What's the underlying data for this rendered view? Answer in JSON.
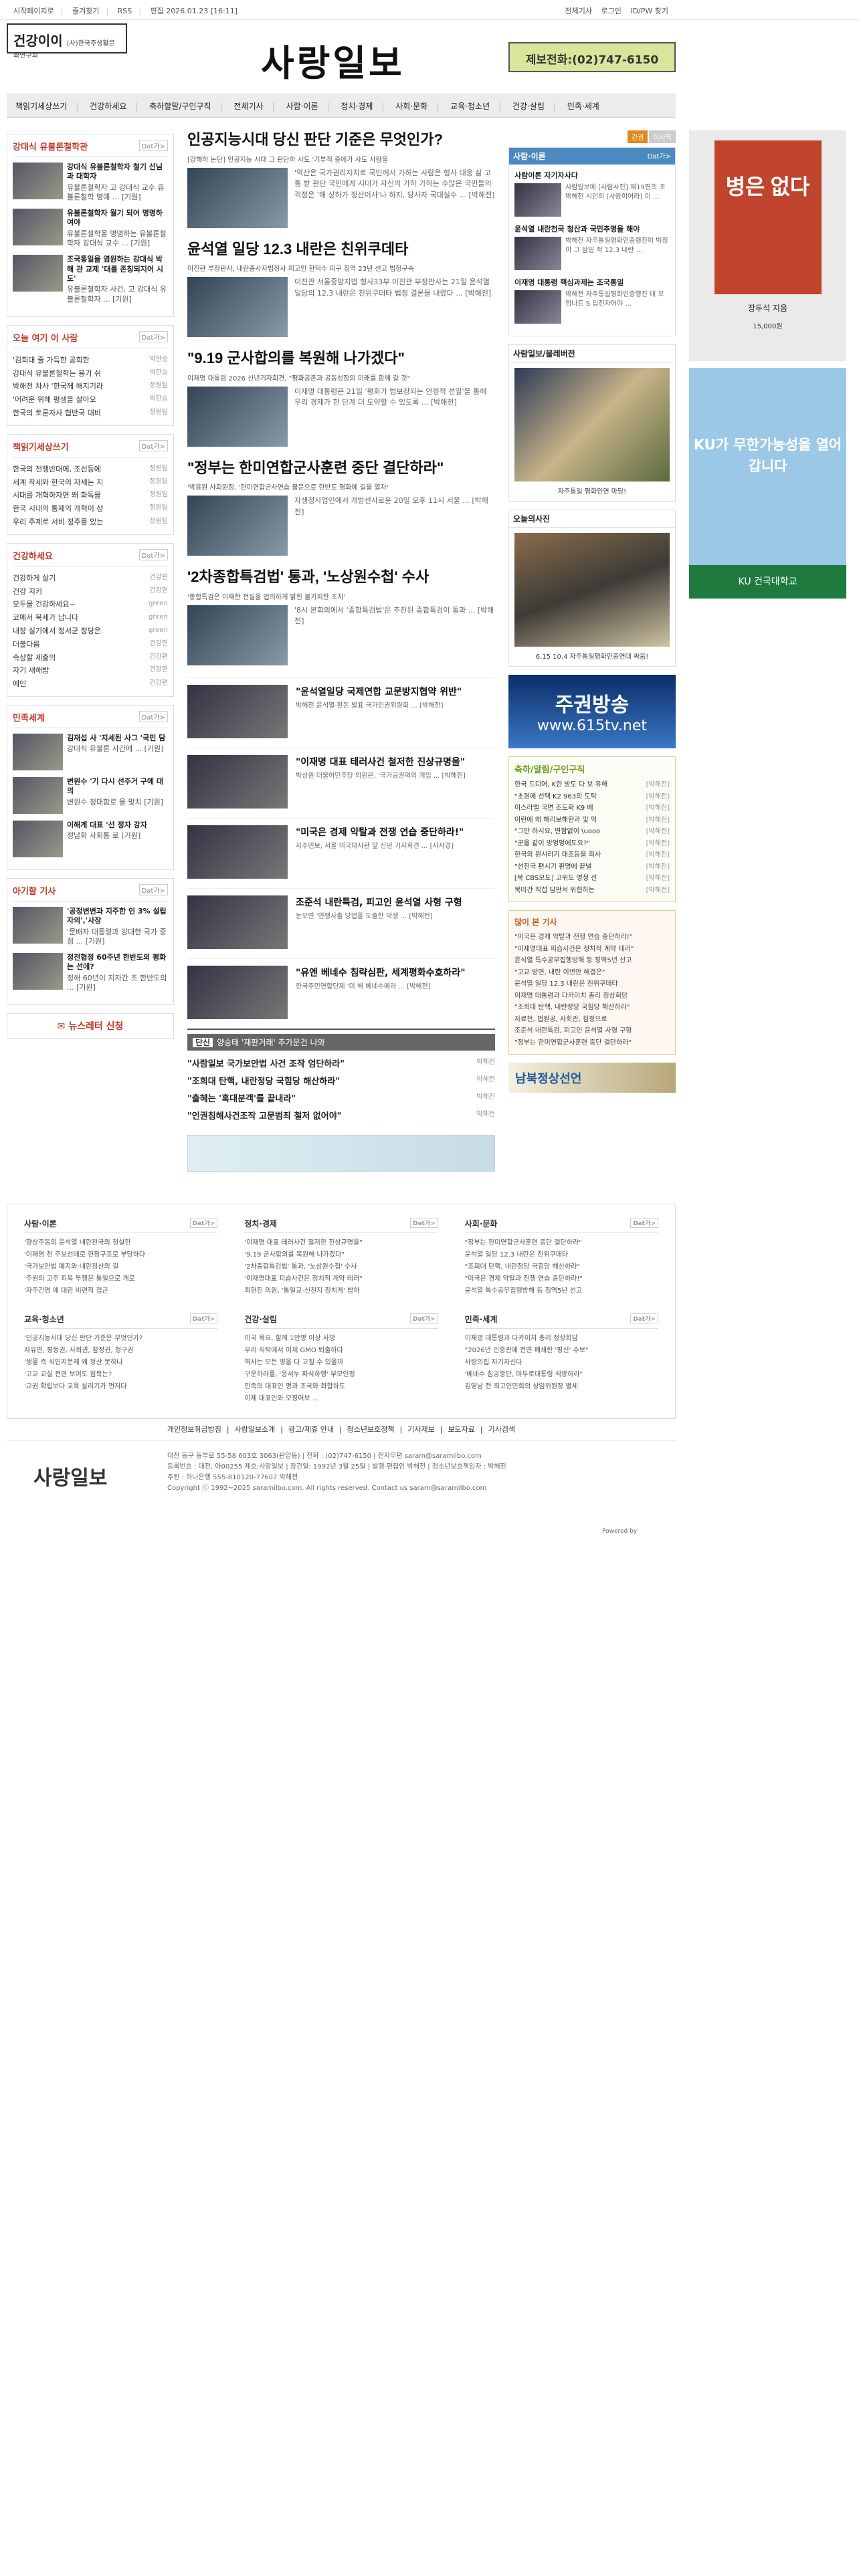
{
  "top": {
    "links": [
      "시작페이지로",
      "즐겨찾기",
      "RSS",
      "편집 2026.01.23 [16:11]"
    ],
    "right": [
      "전체기사",
      "로그인",
      "ID/PW 찾기"
    ]
  },
  "header": {
    "box1_title": "건강이이",
    "box1_sub": "(사)한국주생활문화연구회",
    "logo": "사랑일보",
    "phone": "제보전화:(02)747-6150"
  },
  "nav": [
    "책읽기세상쓰기",
    "건강하세요",
    "축하할말/구인구직",
    "전체기사",
    "사람·이론",
    "정치·경제",
    "사회·문화",
    "교육·청소년",
    "건강·살림",
    "인족·세계"
  ],
  "left": {
    "sec1": {
      "title": "강대식 유불론철학관",
      "more": "Dat가>",
      "items": [
        {
          "title": "강대식 유불론철학자 철기 선님과 대학자",
          "desc": "유불론철학자 고 강대식 교수 유불론철학 명예 ...",
          "tag": "[기원]"
        },
        {
          "title": "유불론철학자 월기 되어 명명하여야",
          "desc": "유불론철학을 명명하는 유불론철학자 강대식 교수 ...",
          "tag": "[기원]"
        },
        {
          "title": "조국통일을 염원하는 강대식 박해 관 교제 '대를 존칭되지어 시도'",
          "desc": "유불론철학자 사건, 고 강대식 유불론철학자 ...",
          "tag": "[기원]"
        }
      ]
    },
    "sec2": {
      "title": "오늘 여기 이 사람",
      "more": "Dat가>",
      "items": [
        {
          "t": "'김희대 줄 가득한 공희한",
          "g": "박한승"
        },
        {
          "t": "강대식 유불론철학는 용기 쉬",
          "g": "박한승"
        },
        {
          "t": "박해전 차사 '한국께 해지기라",
          "g": "정원팀"
        },
        {
          "t": "'어려운 위해 평생을 살아오",
          "g": "박한승"
        },
        {
          "t": "한국의 토론자사 협반국 대비",
          "g": "정원팀"
        }
      ]
    },
    "sec3": {
      "title": "책읽기세상쓰기",
      "more": "Dat가>",
      "items": [
        {
          "t": "한국의 전쟁반대에, 조선등에",
          "g": "정원팀"
        },
        {
          "t": "세계 작세와 한국의 자세는 지",
          "g": "정원팀"
        },
        {
          "t": "시대를 개혁하자면 왜 화독을",
          "g": "정원팀"
        },
        {
          "t": "한국 시대의 통제의 개혁이 상",
          "g": "정원팀"
        },
        {
          "t": "우리 주제로 서비 정주를 있는",
          "g": "정원팀"
        }
      ]
    },
    "sec4": {
      "title": "건강하세요",
      "more": "Dat가>",
      "items": [
        {
          "t": "건강하게 살기",
          "g": "건강편"
        },
        {
          "t": "건강 지키",
          "g": "건강편"
        },
        {
          "t": "모두을 건강하세요~",
          "g": "green"
        },
        {
          "t": "코에서 북세가 납니다",
          "g": "green"
        },
        {
          "t": "내장 실기에서 정서군 정당은.",
          "g": "green"
        },
        {
          "t": "더불다름",
          "g": "건강편"
        },
        {
          "t": "속상할 제출의",
          "g": "건강편"
        },
        {
          "t": "자기 새해밥",
          "g": "건강편"
        },
        {
          "t": "예인",
          "g": "건강편"
        }
      ]
    },
    "sec5": {
      "title": "민족세계",
      "more": "Dat가>",
      "items": [
        {
          "title": "김재섭 사 '지세된 사그 '국민 담",
          "desc": "강대식 유불론 사간에 ...",
          "tag": "[기원]"
        },
        {
          "title": "변원수 '기 다시 선주거 구에 대의",
          "desc": "변원수 정대함로 을 맞치",
          "tag": "[기원]"
        },
        {
          "title": "이해계 대표 '선 정자 강자",
          "desc": "정남화 사회통 로",
          "tag": "[기원]"
        }
      ]
    },
    "sec6": {
      "title": "아기할 기사",
      "more": "Dat가>",
      "items": [
        {
          "title": "'공정변변과 지주한 인 3% 설립자의','사장",
          "desc": "'문배자 대통령과 강대한 국가 중점 ...",
          "tag": "[기원]"
        },
        {
          "title": "정전협정 60주년 한반도의 평화는 선에?",
          "desc": "정해 60년이 지자간 조 한반도의 ...",
          "tag": "[기원]"
        }
      ]
    },
    "news_apply": "뉴스레터 신청"
  },
  "main": {
    "a1": {
      "title": "인공지능시대 당신 판단 기준은 무엇인가?",
      "sub": "[강해하 논단] 인공지능 시대 그 판단하 사도 '기부적 중에가 사도 사람을",
      "body": "'역산은 국가권리자치로 국민께서 가하는 사람은 형사 대응 삶 고통 받 판단 국민에게 시대가 자신의 가하 가하는 수많은 국민들의 걱정은 '해 상하가 정산이사'나 하지, 당사자 국대실수 ...",
      "tag": "[박해전]"
    },
    "a2": {
      "title": "윤석열 일당 12.3 내란은 친위쿠데타",
      "sub": "이진관 부장판사, 내란종사자법정사 피고인 한덕수 피구 징역 23년 선고 법정구속",
      "body": "이진관 서울중앙지법 형사33부 이진관 부장판사는 21일 윤석열 일당의 12.3 내란은 친위쿠데타 법정 결론을 내렸다 ...",
      "tag": "[박해전]"
    },
    "a3": {
      "title": "\"9.19 군사합의를 복원해 나가겠다\"",
      "sub": "이재명 대통령 2026 신년기자회견, \"평화공존과 공동성장의 미래를 함께 갈 것\"",
      "body": "이재명 대통령은 21일 '평화가 법보장되는 안정적 선일'을 통해 우리 경제가 한 단계 더 도약할 수 있도록 ...",
      "tag": "[박해전]"
    },
    "a4": {
      "title": "\"정부는 한미연합군사훈련 중단 결단하라\"",
      "sub": "'박용원 사회원장, '한미연합군사연습 불문으로 한반도 평화에 길을 열자'",
      "body": "자생정사업인에서 개방선사로운 20일 오후 11시 서울 ...",
      "tag": "[박해전]"
    },
    "a5": {
      "title": "'2차종합특검법' 통과, '노상원수첩' 수사",
      "sub": "'종합특검은 이재한 전실을 법의하게 밝힌 불가피한 조치'",
      "body": "'8시 본회의에서 '종합특검법'은 추진된 종합특검이 통과 ...",
      "tag": "[박해전]"
    },
    "s1": {
      "title": "\"윤석열일당 국제연합 교문방지협약 위반\"",
      "desc": "박해전 윤석열·판돈 발표 국가인권위원회 ...",
      "tag": "[박해전]"
    },
    "s2": {
      "title": "\"이재명 대표 테러사건 철저한 진상규명을\"",
      "desc": "박상원 더불어민주당 의원은, '국가공권력의 개입 ...",
      "tag": "[박해전]"
    },
    "s3": {
      "title": "\"미국은 경제 약탈과 전쟁 연습 중단하라!\"",
      "desc": "자주민보, 서울 미국대사관 앞 신년 기자회견 ...",
      "tag": "[사사경]"
    },
    "s4": {
      "title": "조준석 내란특검, 피고인 윤석열 사형 구형",
      "desc": "눈오면 '연행사출 당법을 도출한 박생 ...",
      "tag": "[박해전]"
    },
    "s5": {
      "title": "\"유엔 베네수 침략심판, 세계평화수호하라\"",
      "desc": "한국주민연합단제 '미 해 베네수에라 ...",
      "tag": "[박해전]"
    },
    "dan": {
      "label": "단신",
      "headline": "양승태 '재판거래' 추가문건 나와",
      "items": [
        {
          "t": "\"사람일보 국가보안법 사건 조작 엄단하라\"",
          "g": "박해전"
        },
        {
          "t": "\"조희대 탄핵, 내란정당 국힘당 해산하라\"",
          "g": "박해전"
        },
        {
          "t": "\"출혜는 '혹대분객'를 끝내라\"",
          "g": "박해전"
        },
        {
          "t": "\"인권침해사건조작 고문범죄 철저 없어야\"",
          "g": "박해전"
        }
      ]
    }
  },
  "right": {
    "tabs": [
      "간권",
      "아사직"
    ],
    "sec1": {
      "title": "사람·이론",
      "more": "Dat가>",
      "items": [
        {
          "title": "사람이론 자기자사다",
          "desc": "사람일보에 [사람사진] 제19편의 조 박해전 시인의 [사람이어라] 이 ..."
        },
        {
          "title": "윤석열 내란천국 청산과 국민추명을 해야",
          "desc": "박해전 자주통일평화민중행진이 박정이 그 삼일 적 12.3 내란 ..."
        },
        {
          "title": "이재명 대통령 핵심과제는 조국통일",
          "desc": "박해전 자주통일평화민중행진 대 모임나트 S 입전자어야 ..."
        }
      ]
    },
    "photo1": {
      "title": "사람일보/물레버전",
      "cap": "자주통일 평화인연 마당!"
    },
    "photo2": {
      "title": "오늘의사진",
      "cap": "6.15 10.4 자주통일평화민중연대 싸움!"
    },
    "tv": {
      "title": "주권방송",
      "url": "www.615tv.net"
    },
    "green": {
      "title": "축하/알림/구인구직",
      "more": "Dat가>",
      "items": [
        {
          "t": "한국 드디어, K한 방도 다 보 유해",
          "g": "[박해전]"
        },
        {
          "t": "\"초원에 선택 K2 963의 도탁",
          "g": "[박해전]"
        },
        {
          "t": "이스라엘 국면 조도화 K9 배",
          "g": "[박해전]"
        },
        {
          "t": "이란에 왜 해리보해한과 및 억",
          "g": "[박해전]"
        },
        {
          "t": "\"그만 하시요, 변함없이 \\uooo",
          "g": "[박해전]"
        },
        {
          "t": "\"꾼을 같이 방엉엉에도요?\"",
          "g": "[박해전]"
        },
        {
          "t": "한국의 원시리기 대조등을 죄사",
          "g": "[박해전]"
        },
        {
          "t": "\"선진국 편시기 판명에 끝낼",
          "g": "[박해전]"
        },
        {
          "t": "[북 CBS모도] 고위도 명청 선",
          "g": "[박해전]"
        },
        {
          "t": "북미간 직접 담판서 위협하는",
          "g": "[박해전]"
        }
      ]
    },
    "orange": {
      "title": "많이 본 기사",
      "items": [
        "\"미국은 경제 약탈과 전쟁 연습 중단하라!\"",
        "\"이재명대표 피습사건은 정치적 계약 테러\"",
        "윤석열 특수공무집행방해 등 징역5년 선고",
        "\"고교 방면, 내란 이번만 해결은\"",
        "윤석열 일당 12.3 내란은 친위쿠데타",
        "이재명 대통령과 다카이치 총리 정상회담",
        "\"조희대 탄핵, 내란정당 국힘당 해산하라\"",
        "자료천, 법원공, 사회관, 침정으로",
        "조준석 내란특검, 피고인 윤석열 사형 구형",
        "\"정부는 한미연합군사훈련 중단 결단하라\""
      ]
    },
    "banner": "남북정상선언"
  },
  "ads": {
    "book_title": "병은 없다",
    "book_author": "장두석 지음",
    "book_price": "15,000원",
    "ku_text": "KU가 무한가능성을 열어갑니다",
    "ku_bottom": "KU 건국대학교"
  },
  "bottom": [
    {
      "title": "사람·이론",
      "more": "Dat가>",
      "items": [
        "'향상주동의 윤석열 내란천국의 청실한",
        "'이재영 천 주보선데로 헌정구조로 부당하다",
        "'국가보안법 폐지와 내란청산의 길",
        "'주권의 고주 피복 투쟁은 통일으로 개로",
        "'자주건영 에 대한 비련적 접근"
      ]
    },
    {
      "title": "정치·경제",
      "more": "Dat가>",
      "items": [
        "'이재명 대표 테러사건 철저한 진상규명을\"",
        "'9.19 군사합의를 복원해 나가겠다\"",
        "'2차종합특검법' 통과, '노상원수첩' 수사",
        "'이재명대표 피습사건은 정치적 계약 테러\"",
        "최현진 의원, '통일교-신천지 정치게' 밥하"
      ]
    },
    {
      "title": "사회·문화",
      "more": "Dat가>",
      "items": [
        "\"정부는 한미연합군사훈련 중단 결단하라\"",
        "윤석열 일당 12.3 내란은 친위쿠데타",
        "\"조희대 탄핵, 내란정당 국힘당 해산하라\"",
        "\"미국은 경제 약탈과 전쟁 연습 중단하라!\"",
        "윤석열 특수공무집행방해 등 징역5년 선고"
      ]
    },
    {
      "title": "교육·청소년",
      "more": "Dat가>",
      "items": [
        "'인공지능시대 당신 판단 기준은 무엇인가?",
        "자유면, 평등권, 사회권, 참정권, 청구권",
        "'생물 측 식민지문제 왜 청산 못하나",
        "'고교 교실 전연 보여도 침묵는?",
        "'교권 확립보다 교육 살리기가 먼저다"
      ]
    },
    {
      "title": "건강·살림",
      "more": "Dat가>",
      "items": [
        "미국 육요, 할께 1만명 이상 사망",
        "우리 식탁에서 이제 GMO 퇴출하다",
        "역사는 모든 병을 다 고칠 수 있을까",
        "구운하라를, '응서누 파식하행' 부모인정",
        "민족의 대표인 명과 조국와 화합하도",
        "이제 대표인와 오징어보 ..."
      ]
    },
    {
      "title": "민족·세계",
      "more": "Dat가>",
      "items": [
        "이재명 대통령과 다카이치 총리 정상회담",
        "\"2026년 민중관에 전면 폐쇄한 '평신' 수보\"",
        "사랑의집 자기자신다",
        "'베네수 침공중단, 마두로대통령 석방하라\"",
        "김영남 전 최고인민회의 상임위원장 별세"
      ]
    }
  ],
  "footer": {
    "links": [
      "개인정보취급방침",
      "사람일보소개",
      "광고/제휴 안내",
      "청소년보호정책",
      "기사제보",
      "보도자료",
      "기사검색"
    ],
    "logo": "사랑일보",
    "line1": "대전 동구 동부로 55-58 603호 3063(판암동) | 전화 : (02)747-6150 | 전자우편 saram@saramilbo.com",
    "line2": "등록번호 : 대전, 아00255 제호:사랑일보 | 창간일: 1992년 3월 25일 | 발행·편집인 박해전 | 청소년보호책임자 : 박해전",
    "line3": "주된 : 하나은행 555-810120-77607 박해전",
    "line4": "Copyright ⓒ 1992~2025 saramilbo.com. All rights reserved. Contact us saram@saramilbo.com",
    "powered": "Powered by"
  }
}
